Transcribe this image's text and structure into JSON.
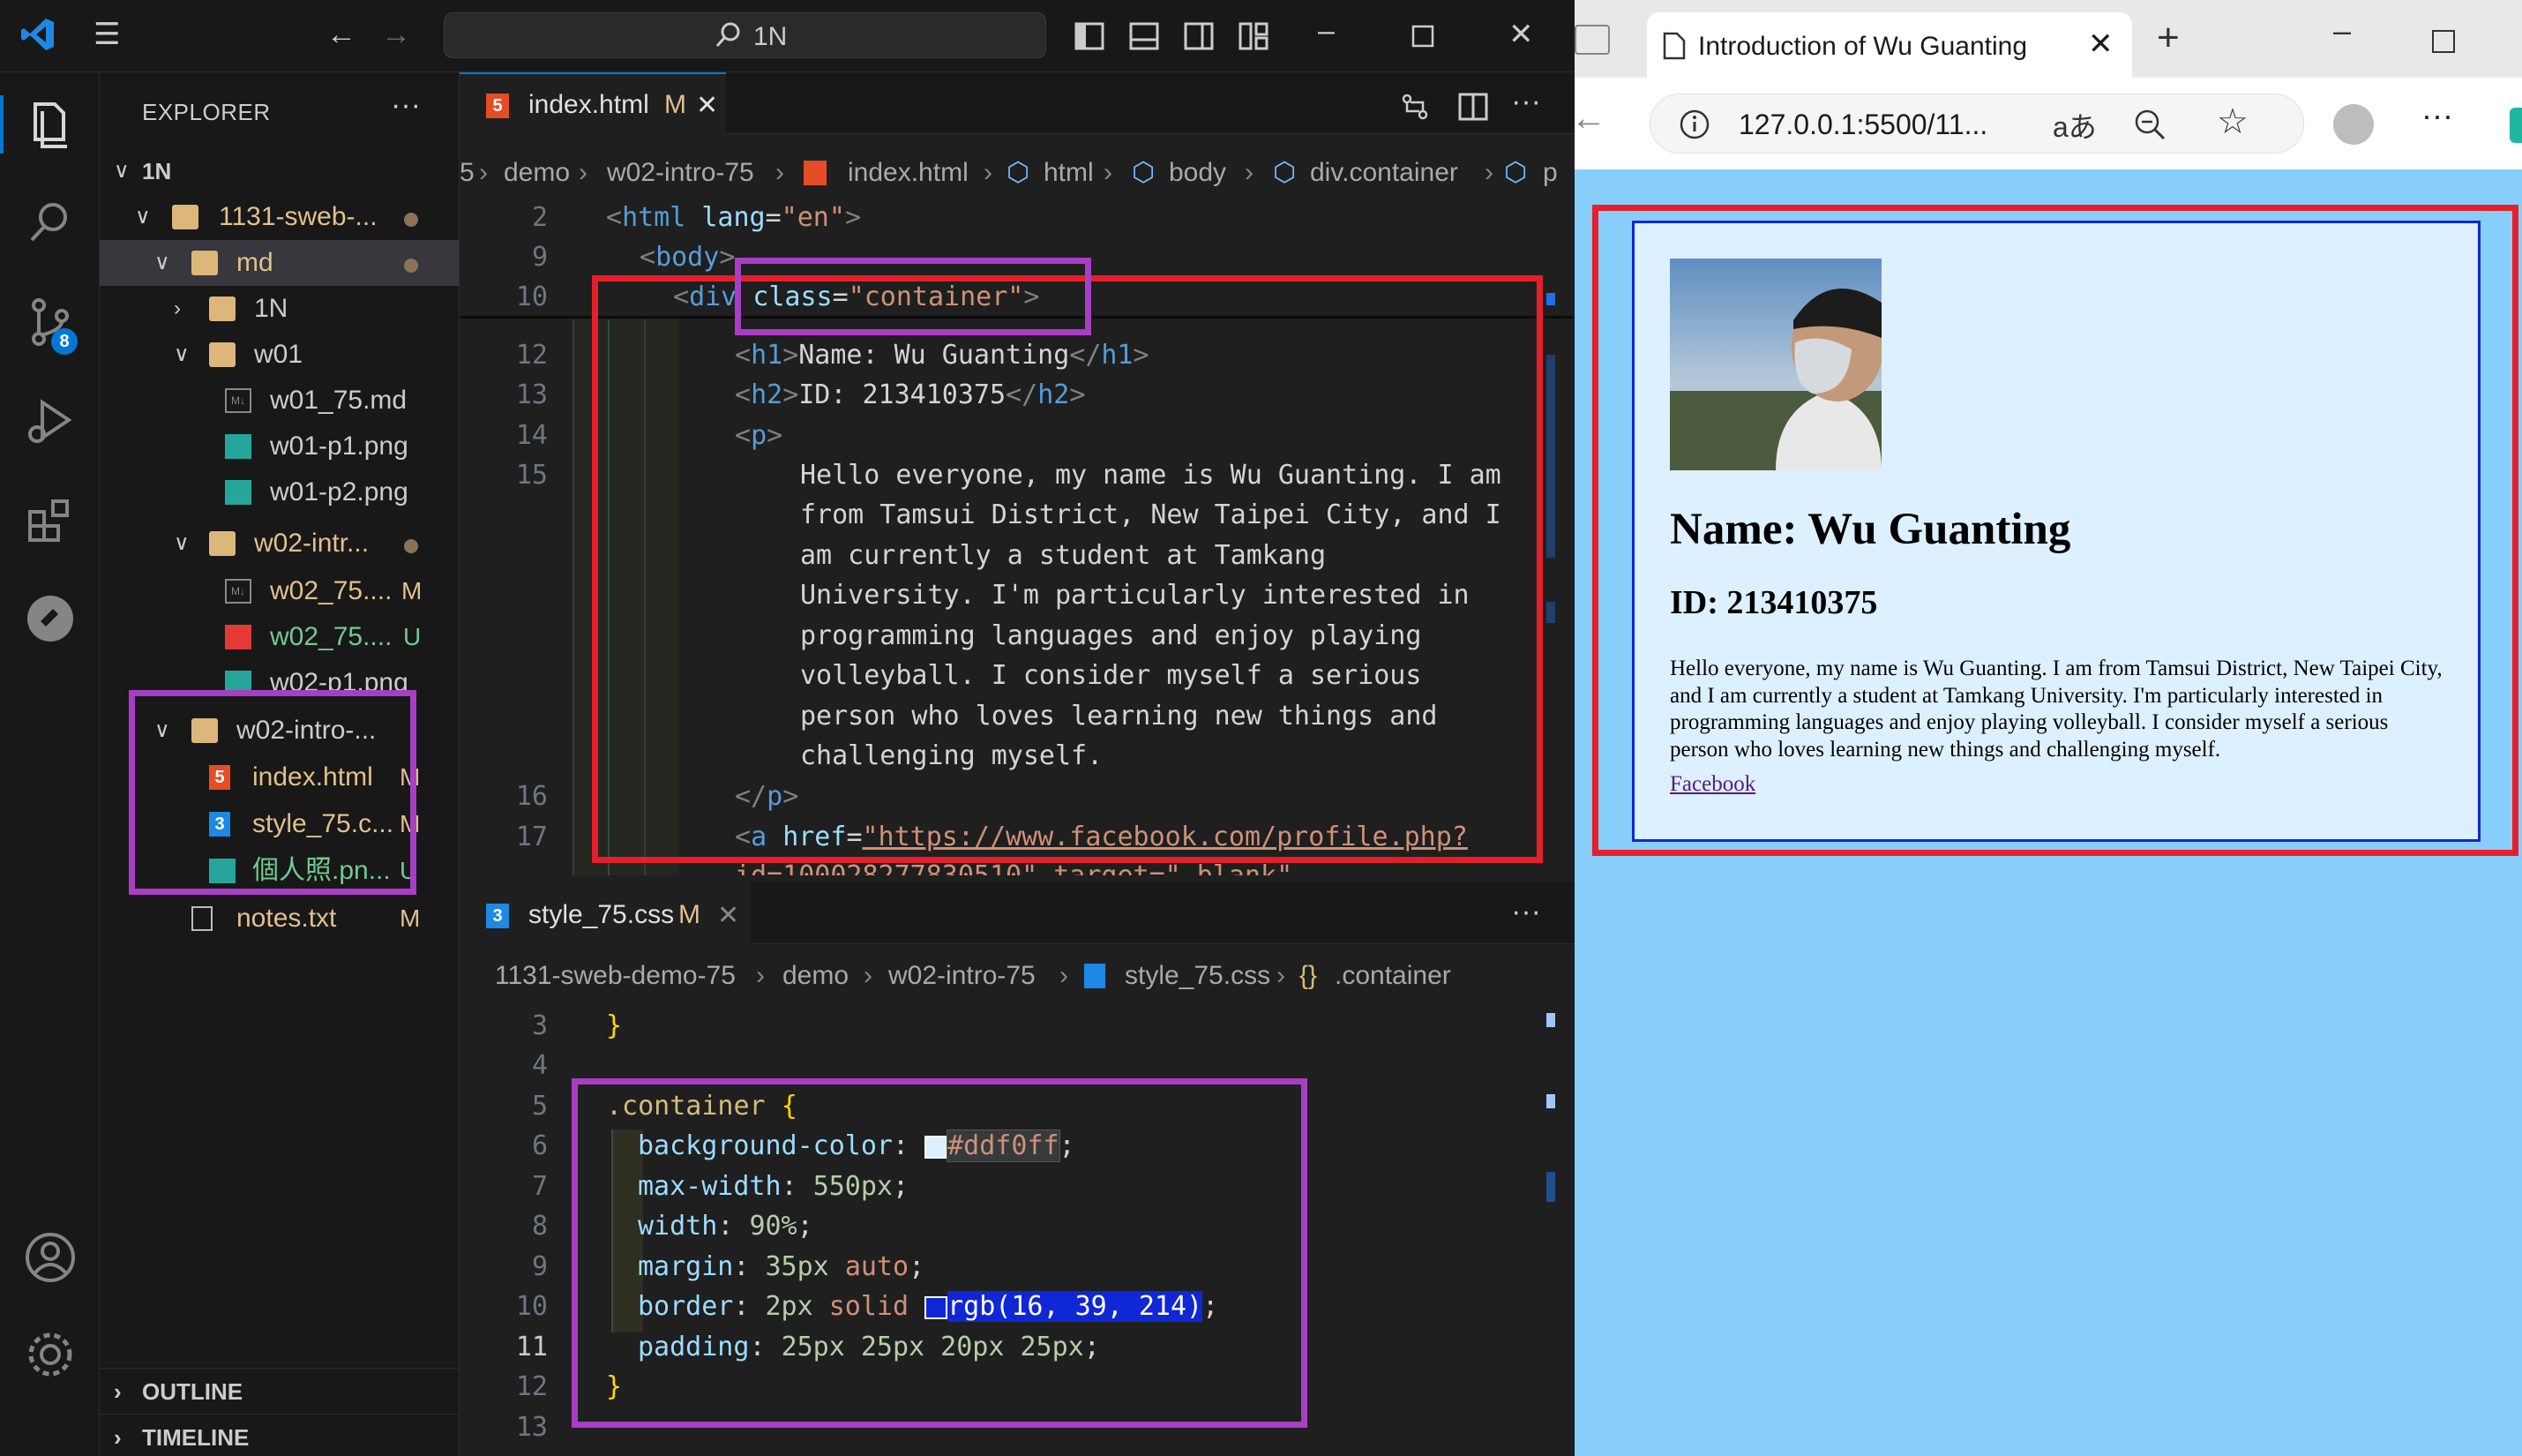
{
  "vscode": {
    "command_center": "1N",
    "explorer_title": "EXPLORER",
    "explorer_more": "···",
    "tree": [
      {
        "label": "1N",
        "chev": "∨"
      },
      {
        "label": "1131-sweb-...",
        "chev": "∨"
      },
      {
        "label": "md",
        "chev": "∨"
      },
      {
        "label": "1N",
        "chev": "›"
      },
      {
        "label": "w01",
        "chev": "∨"
      },
      {
        "label": "w01_75.md"
      },
      {
        "label": "w01-p1.png"
      },
      {
        "label": "w01-p2.png"
      },
      {
        "label": "w02-intr...",
        "chev": "∨"
      },
      {
        "label": "w02_75....",
        "status": "M"
      },
      {
        "label": "w02_75....",
        "status": "U"
      },
      {
        "label": "w02-p1.png"
      },
      {
        "label": "w02-intro-...",
        "chev": "∨"
      },
      {
        "label": "index.html",
        "status": "M"
      },
      {
        "label": "style_75.c...",
        "status": "M"
      },
      {
        "label": "個人照.pn...",
        "status": "U"
      },
      {
        "label": "notes.txt",
        "status": "M"
      }
    ],
    "sections": {
      "outline": "OUTLINE",
      "timeline": "TIMELINE"
    },
    "badge_count": "8",
    "editor1": {
      "tab_label": "index.html",
      "tab_status": "M",
      "breadcrumb": [
        "5",
        "demo",
        "w02-intro-75",
        "index.html",
        "html",
        "body",
        "div.container",
        "p"
      ],
      "lines": [
        "2",
        "9",
        "10",
        "12",
        "13",
        "14",
        "15",
        "",
        "",
        "",
        "",
        "",
        "",
        "",
        "16",
        "17",
        ""
      ],
      "code": {
        "l2": "<html lang=\"en\">",
        "l9": "<body>",
        "l10_div": "<div ",
        "l10_class": "class=\"container\">",
        "l12": "<h1>Name: Wu Guanting</h1>",
        "l13": "<h2>ID: 213410375</h2>",
        "l14": "<p>",
        "p_lines": [
          "Hello everyone, my name is Wu Guanting. I am",
          "from Tamsui District, New Taipei City, and I",
          "am currently a student at Tamkang",
          "University. I'm particularly interested in",
          "programming languages and enjoy playing",
          "volleyball. I consider myself a serious",
          "person who loves learning new things and",
          "challenging myself."
        ],
        "l16": "</p>",
        "l17_a": "<a ",
        "l17_href": "href=",
        "l17_url": "\"https://www.facebook.com/profile.php?",
        "l18": "id=100028277830510\" target=\"_blank\""
      }
    },
    "editor2": {
      "tab_label": "style_75.css",
      "tab_status": "M",
      "more": "···",
      "breadcrumb": [
        "1131-sweb-demo-75",
        "demo",
        "w02-intro-75",
        "style_75.css",
        ".container"
      ],
      "lines": [
        "3",
        "4",
        "5",
        "6",
        "7",
        "8",
        "9",
        "10",
        "11",
        "12",
        "13"
      ],
      "code": {
        "l3": "}",
        "l5_sel": ".container {",
        "l6_prop": "background-color:",
        "l6_val": "#ddf0ff",
        "l7": "max-width: 550px;",
        "l8": "width: 90%;",
        "l9": "margin: 35px auto;",
        "l10_prop": "border: 2px solid",
        "l10_val": "rgb(16, 39, 214)",
        "l11": "padding: 25px 25px 20px 25px;",
        "l12": "}"
      }
    }
  },
  "browser": {
    "tab_title": "Introduction of Wu Guanting",
    "url": "127.0.0.1:5500/11...",
    "page": {
      "h1": "Name: Wu Guanting",
      "h2": "ID: 213410375",
      "p": "Hello everyone, my name is Wu Guanting. I am from Tamsui District, New Taipei City, and I am currently a student at Tamkang University. I'm particularly interested in programming languages and enjoy playing volleyball. I consider myself a serious person who loves learning new things and challenging myself.",
      "link": "Facebook"
    },
    "colors": {
      "viewport_bg": "#87cefa",
      "container_bg": "#ddf0ff",
      "container_border": "rgb(16, 39, 214)"
    }
  }
}
